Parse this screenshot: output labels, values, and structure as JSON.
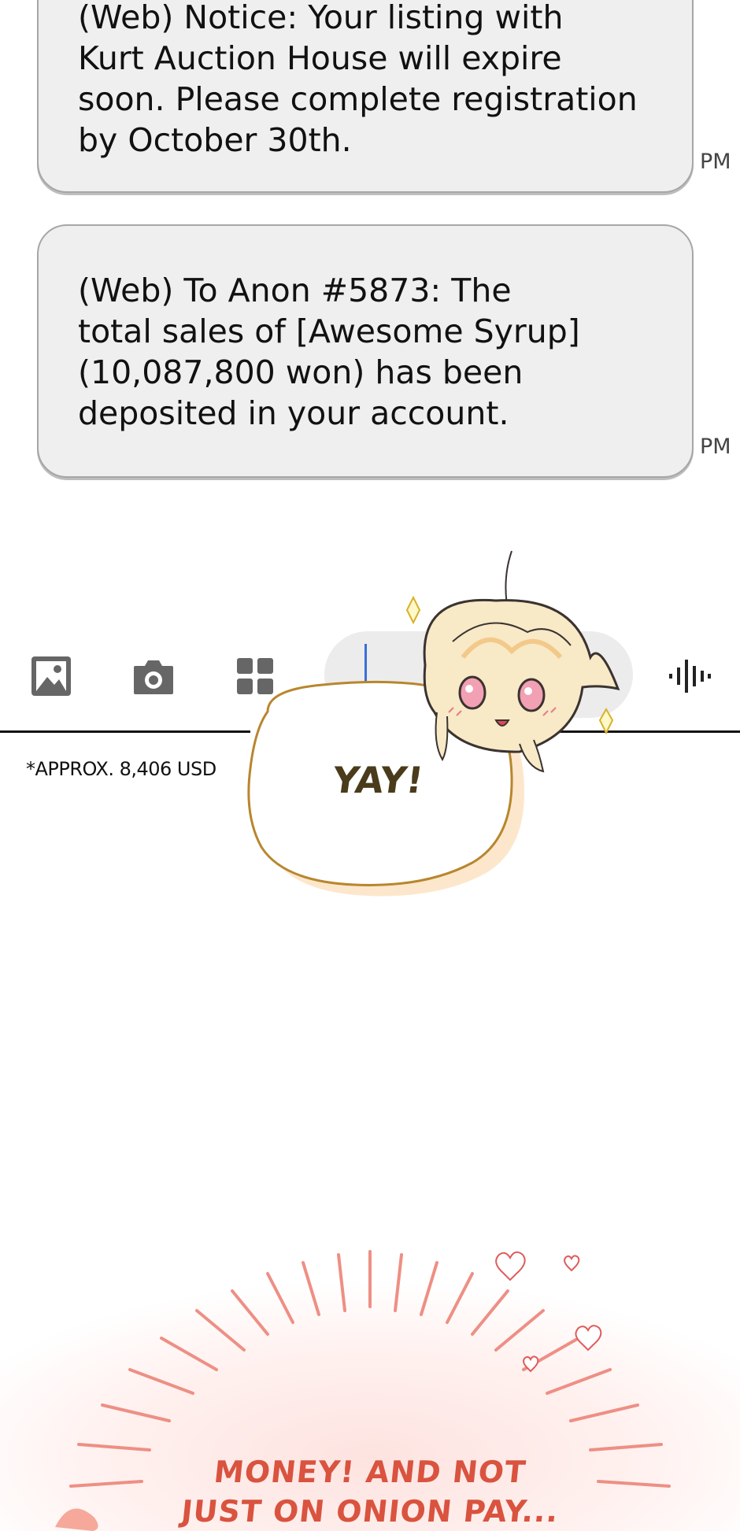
{
  "messages": [
    {
      "text": "(Web) Notice: Your listing with\nKurt Auction House will expire\nsoon. Please complete registration\nby October 30th.",
      "time": "PM"
    },
    {
      "text": "(Web) To Anon #5873: The\ntotal sales of [Awesome Syrup]\n(10,087,800 won) has been\ndeposited in your account.",
      "time": "PM"
    }
  ],
  "toolbar": {
    "icons": [
      "image-icon",
      "camera-icon",
      "apps-grid-icon",
      "voice-waveform-icon"
    ]
  },
  "footnote": "*APPROX. 8,406 USD",
  "speech": "YAY!",
  "caption_lines": [
    "MONEY! AND NOT",
    "JUST ON ONION PAY..."
  ],
  "colors": {
    "bubble": "#efefef",
    "caption": "#d9533f",
    "yay_outline": "#b8862e"
  }
}
